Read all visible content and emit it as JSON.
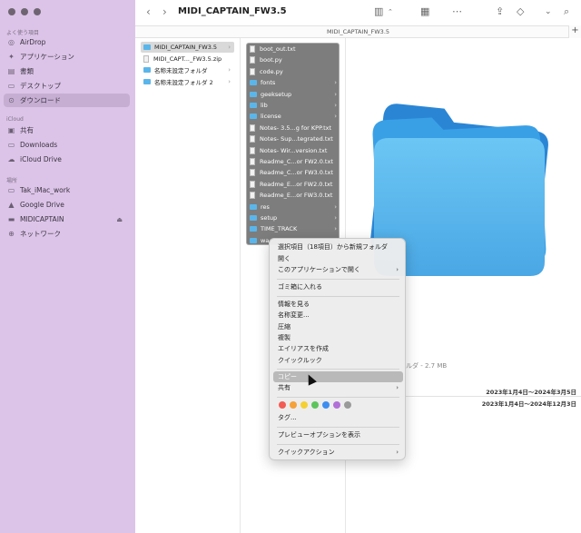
{
  "window": {
    "title": "MIDI_CAPTAIN_FW3.5",
    "path_title": "MIDI_CAPTAIN_FW3.5"
  },
  "sidebar": {
    "favorites_header": "よく使う項目",
    "favorites": [
      {
        "label": "AirDrop",
        "icon": "airdrop-icon"
      },
      {
        "label": "アプリケーション",
        "icon": "applications-icon"
      },
      {
        "label": "書類",
        "icon": "documents-icon"
      },
      {
        "label": "デスクトップ",
        "icon": "desktop-icon"
      },
      {
        "label": "ダウンロード",
        "icon": "downloads-icon",
        "selected": true
      }
    ],
    "icloud_header": "iCloud",
    "icloud": [
      {
        "label": "共有",
        "icon": "shared-icon"
      },
      {
        "label": "Downloads",
        "icon": "folder-icon"
      },
      {
        "label": "iCloud Drive",
        "icon": "cloud-icon"
      }
    ],
    "locations_header": "場所",
    "locations": [
      {
        "label": "Tak_iMac_work",
        "icon": "computer-icon"
      },
      {
        "label": "Google Drive",
        "icon": "drive-icon"
      },
      {
        "label": "MIDICAPTAIN",
        "icon": "disk-icon",
        "eject": "⏏"
      },
      {
        "label": "ネットワーク",
        "icon": "network-icon"
      }
    ]
  },
  "toolbar": {
    "back": "‹",
    "forward": "›",
    "plus": "+"
  },
  "column1": [
    {
      "label": "MIDI_CAPTAIN_FW3.5",
      "type": "folder",
      "chevron": "›",
      "selected": true
    },
    {
      "label": "MIDI_CAPT..._FW3.5.zip",
      "type": "file"
    },
    {
      "label": "名称未設定フォルダ",
      "type": "folder",
      "chevron": "›"
    },
    {
      "label": "名称未設定フォルダ 2",
      "type": "folder",
      "chevron": "›"
    }
  ],
  "column2": [
    {
      "label": "boot_out.txt",
      "type": "file"
    },
    {
      "label": "boot.py",
      "type": "file"
    },
    {
      "label": "code.py",
      "type": "file"
    },
    {
      "label": "fonts",
      "type": "folder",
      "chevron": "›"
    },
    {
      "label": "geeksetup",
      "type": "folder",
      "chevron": "›"
    },
    {
      "label": "lib",
      "type": "folder",
      "chevron": "›"
    },
    {
      "label": "license",
      "type": "folder",
      "chevron": "›"
    },
    {
      "label": "Notes- 3.5...g for KPP.txt",
      "type": "file"
    },
    {
      "label": "Notes- Sup...tegrated.txt",
      "type": "file"
    },
    {
      "label": "Notes- Wir...version.txt",
      "type": "file"
    },
    {
      "label": "Readme_C...or FW2.0.txt",
      "type": "file"
    },
    {
      "label": "Readme_C...or FW3.0.txt",
      "type": "file"
    },
    {
      "label": "Readme_E...or FW2.0.txt",
      "type": "file"
    },
    {
      "label": "Readme_E...or FW3.0.txt",
      "type": "file"
    },
    {
      "label": "res",
      "type": "folder",
      "chevron": "›"
    },
    {
      "label": "setup",
      "type": "folder",
      "chevron": "›"
    },
    {
      "label": "TIME_TRACK",
      "type": "folder",
      "chevron": "›"
    },
    {
      "label": "wa",
      "type": "folder",
      "chevron": "›"
    }
  ],
  "preview": {
    "meta": "ルダ - 2.7 MB",
    "date1": "2023年1月4日〜2024年3月5日",
    "date2": "2023年1月4日〜2024年12月3日"
  },
  "context_menu": {
    "new_folder": "選択項目（18項目）から新規フォルダ",
    "open": "開く",
    "open_with": "このアプリケーションで開く",
    "trash": "ゴミ箱に入れる",
    "get_info": "情報を見る",
    "rename": "名称変更...",
    "compress": "圧縮",
    "duplicate": "複製",
    "alias": "エイリアスを作成",
    "quick_look": "クイックルック",
    "copy": "コピー",
    "share": "共有",
    "tags": "タグ...",
    "preview_options": "プレビューオプションを表示",
    "quick_actions": "クイックアクション",
    "submenu_arrow": "›",
    "tag_colors": [
      "#f25c54",
      "#f5a23a",
      "#f5d033",
      "#5cc55c",
      "#3d8ef0",
      "#b16fd8",
      "#9a9a9a"
    ]
  }
}
